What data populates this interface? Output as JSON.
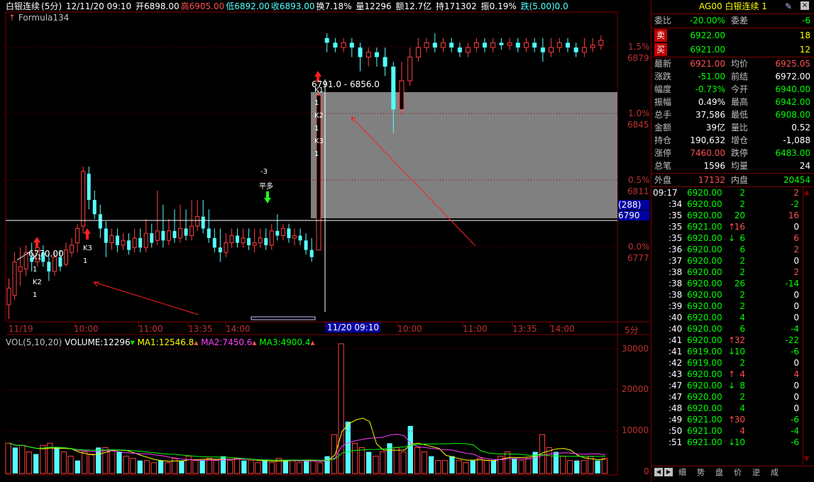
{
  "info_bar": {
    "name": "白银连续",
    "period": "(5分)",
    "datetime": "12/11/20 09:10",
    "open": "开6898.00",
    "high": "高6905.00",
    "low": "低6892.00",
    "close": "收6893.00",
    "turnover": "换7.18%",
    "volume": "量12296",
    "amount": "额12.7亿",
    "hold": "持171302",
    "amplitude": "振0.19%",
    "change": "跌(5.00)0.0"
  },
  "formula": "Formula134",
  "right_axis": {
    "pct_labels": [
      "1.5%",
      "1.0%",
      "0.5%",
      "0.0%"
    ],
    "price_labels": [
      "6879",
      "6845",
      "6811",
      "6777"
    ],
    "cursor_count": "(288)",
    "cursor_price": "6790"
  },
  "chart_annotations": {
    "left_price": "6770.00",
    "left_labels": [
      "K1",
      "1",
      "K2",
      "1"
    ],
    "left_k3": [
      "K3",
      "1"
    ],
    "mid_num": "-3",
    "mid_text": "平多",
    "range_text": "6791.0 - 6856.0",
    "right_labels": [
      "K1",
      "1",
      "K2",
      "1",
      "K3",
      "1"
    ]
  },
  "time_axis": {
    "labels": [
      "11/19",
      "10:00",
      "11:00",
      "13:35",
      "14:00",
      "10:00",
      "11:00",
      "13:35",
      "14:00",
      "5分"
    ],
    "cursor": "11/20 09:10"
  },
  "volume_bar": {
    "title": "VOL(5,10,20)",
    "volume": "VOLUME:12296",
    "ma1": "MA1:12546.8",
    "ma2": "MA2:7450.6",
    "ma3": "MA3:4900.4",
    "axis": [
      "30000",
      "20000",
      "10000",
      "0"
    ]
  },
  "chart_data": {
    "type": "candlestick",
    "candles_left": [
      [
        6768,
        6775,
        6762,
        6779
      ],
      [
        6772,
        6786,
        6770,
        6790
      ],
      [
        6782,
        6784,
        6776,
        6792
      ],
      [
        6783,
        6790,
        6780,
        6793
      ],
      [
        6788,
        6786,
        6782,
        6794
      ],
      [
        6786,
        6792,
        6784,
        6795
      ],
      [
        6790,
        6786,
        6784,
        6793
      ],
      [
        6786,
        6782,
        6778,
        6790
      ],
      [
        6782,
        6788,
        6780,
        6790
      ],
      [
        6788,
        6784,
        6782,
        6791
      ],
      [
        6785,
        6791,
        6784,
        6794
      ],
      [
        6790,
        6793,
        6788,
        6796
      ],
      [
        6794,
        6800,
        6790,
        6802
      ],
      [
        6801,
        6824,
        6798,
        6826
      ],
      [
        6823,
        6812,
        6808,
        6826
      ],
      [
        6812,
        6806,
        6804,
        6816
      ],
      [
        6806,
        6800,
        6796,
        6810
      ],
      [
        6800,
        6794,
        6788,
        6803
      ],
      [
        6794,
        6797,
        6791,
        6800
      ],
      [
        6797,
        6793,
        6790,
        6800
      ],
      [
        6793,
        6795,
        6791,
        6798
      ],
      [
        6795,
        6791,
        6789,
        6798
      ],
      [
        6792,
        6796,
        6790,
        6800
      ],
      [
        6796,
        6792,
        6790,
        6800
      ],
      [
        6792,
        6798,
        6790,
        6804
      ],
      [
        6798,
        6794,
        6792,
        6802
      ],
      [
        6795,
        6799,
        6793,
        6816
      ],
      [
        6799,
        6795,
        6792,
        6810
      ],
      [
        6795,
        6799,
        6793,
        6804
      ],
      [
        6799,
        6796,
        6794,
        6808
      ],
      [
        6796,
        6800,
        6794,
        6810
      ],
      [
        6800,
        6797,
        6795,
        6808
      ],
      [
        6797,
        6801,
        6795,
        6812
      ],
      [
        6801,
        6805,
        6799,
        6812
      ],
      [
        6805,
        6800,
        6798,
        6812
      ],
      [
        6800,
        6796,
        6794,
        6808
      ],
      [
        6796,
        6792,
        6790,
        6800
      ],
      [
        6792,
        6790,
        6786,
        6800
      ],
      [
        6790,
        6794,
        6788,
        6798
      ],
      [
        6794,
        6797,
        6792,
        6800
      ],
      [
        6797,
        6794,
        6792,
        6800
      ],
      [
        6794,
        6796,
        6792,
        6800
      ],
      [
        6796,
        6793,
        6791,
        6800
      ],
      [
        6793,
        6794,
        6790,
        6800
      ],
      [
        6794,
        6796,
        6792,
        6800
      ],
      [
        6796,
        6793,
        6791,
        6800
      ],
      [
        6793,
        6799,
        6791,
        6802
      ],
      [
        6799,
        6797,
        6795,
        6806
      ],
      [
        6797,
        6800,
        6795,
        6802
      ],
      [
        6800,
        6796,
        6794,
        6802
      ],
      [
        6796,
        6797,
        6793,
        6800
      ],
      [
        6797,
        6795,
        6793,
        6800
      ],
      [
        6795,
        6791,
        6789,
        6798
      ],
      [
        6791,
        6788,
        6786,
        6796
      ]
    ],
    "candles_right": [
      [
        6791,
        6856,
        6791,
        6858
      ],
      [
        6880,
        6878,
        6874,
        6882
      ],
      [
        6878,
        6876,
        6874,
        6880
      ],
      [
        6876,
        6878,
        6874,
        6880
      ],
      [
        6878,
        6876,
        6872,
        6880
      ],
      [
        6876,
        6872,
        6866,
        6878
      ],
      [
        6872,
        6874,
        6868,
        6876
      ],
      [
        6874,
        6872,
        6868,
        6876
      ],
      [
        6872,
        6868,
        6864,
        6876
      ],
      [
        6868,
        6850,
        6840,
        6870
      ],
      [
        6850,
        6862,
        6848,
        6870
      ],
      [
        6862,
        6872,
        6860,
        6876
      ],
      [
        6872,
        6876,
        6870,
        6880
      ],
      [
        6876,
        6878,
        6874,
        6880
      ],
      [
        6878,
        6876,
        6874,
        6882
      ],
      [
        6876,
        6878,
        6874,
        6880
      ],
      [
        6878,
        6876,
        6874,
        6880
      ],
      [
        6876,
        6874,
        6872,
        6878
      ],
      [
        6874,
        6876,
        6872,
        6878
      ],
      [
        6876,
        6878,
        6874,
        6880
      ],
      [
        6878,
        6876,
        6874,
        6880
      ],
      [
        6876,
        6878,
        6874,
        6880
      ],
      [
        6878,
        6877,
        6875,
        6880
      ],
      [
        6877,
        6878,
        6875,
        6880
      ],
      [
        6878,
        6876,
        6874,
        6880
      ],
      [
        6876,
        6878,
        6874,
        6880
      ],
      [
        6878,
        6876,
        6874,
        6880
      ],
      [
        6876,
        6874,
        6870,
        6880
      ],
      [
        6874,
        6876,
        6872,
        6880
      ],
      [
        6876,
        6878,
        6874,
        6880
      ],
      [
        6878,
        6876,
        6874,
        6880
      ],
      [
        6876,
        6874,
        6872,
        6878
      ],
      [
        6874,
        6876,
        6872,
        6880
      ],
      [
        6876,
        6877,
        6874,
        6880
      ],
      [
        6877,
        6879,
        6875,
        6881
      ]
    ],
    "volumes": [
      7000,
      6000,
      6500,
      5000,
      4500,
      6500,
      7000,
      6000,
      5000,
      4000,
      3000,
      5000,
      4500,
      6000,
      6000,
      5500,
      5000,
      4000,
      3500,
      3000,
      3000,
      2500,
      3000,
      2500,
      3500,
      3000,
      4000,
      3000,
      3000,
      3500,
      3000,
      4000,
      3000,
      3500,
      3000,
      3000,
      2500,
      3000,
      2500,
      3500,
      3000,
      3000,
      2500,
      3000,
      3000,
      2500,
      4000,
      9000,
      30000,
      12000,
      7000,
      6000,
      5000,
      4000,
      5000,
      7000,
      6000,
      5000,
      11000,
      6000,
      5000,
      4000,
      3000,
      3000,
      4000,
      3000,
      2500,
      3000,
      3500,
      3000,
      3000,
      4000,
      5000,
      3500,
      3000,
      3500,
      5000,
      9000,
      6000,
      5000,
      4000,
      3000,
      3000,
      3000,
      4000,
      3000,
      3500
    ],
    "ylim": [
      6765,
      6890
    ],
    "vol_ylim": [
      0,
      30000
    ]
  },
  "quote": {
    "title_code": "AG00",
    "title_name": "白银连续",
    "title_num": "1",
    "wb_label": "委比",
    "wb_value": "-20.00%",
    "wc_label": "委差",
    "wc_value": "-6",
    "sell_label": "卖",
    "sell_price": "6922.00",
    "sell_vol": "18",
    "buy_label": "买",
    "buy_price": "6921.00",
    "buy_vol": "12",
    "rows": [
      {
        "l1": "最新",
        "v1": "6921.00",
        "l2": "均价",
        "v2": "6925.05",
        "c1": "red",
        "c2": "red"
      },
      {
        "l1": "涨跌",
        "v1": "-51.00",
        "l2": "前结",
        "v2": "6972.00",
        "c1": "green",
        "c2": "white"
      },
      {
        "l1": "幅度",
        "v1": "-0.73%",
        "l2": "今开",
        "v2": "6940.00",
        "c1": "green",
        "c2": "green"
      },
      {
        "l1": "振幅",
        "v1": "0.49%",
        "l2": "最高",
        "v2": "6942.00",
        "c1": "white",
        "c2": "green"
      },
      {
        "l1": "总手",
        "v1": "37,586",
        "l2": "最低",
        "v2": "6908.00",
        "c1": "white",
        "c2": "green"
      },
      {
        "l1": "金额",
        "v1": "39亿",
        "l2": "量比",
        "v2": "0.52",
        "c1": "white",
        "c2": "white"
      },
      {
        "l1": "持仓",
        "v1": "190,632",
        "l2": "增仓",
        "v2": "-1,088",
        "c1": "white",
        "c2": "white"
      },
      {
        "l1": "涨停",
        "v1": "7460.00",
        "l2": "跌停",
        "v2": "6483.00",
        "c1": "red",
        "c2": "green"
      },
      {
        "l1": "总笔",
        "v1": "1596",
        "l2": "均量",
        "v2": "24",
        "c1": "white",
        "c2": "white"
      }
    ],
    "outer_label": "外盘",
    "outer_value": "17132",
    "inner_label": "内盘",
    "inner_value": "20454"
  },
  "trades": [
    {
      "t": "09:17",
      "p": "6920.00",
      "a": "",
      "v": "2",
      "d": "2",
      "pc": "green",
      "dc": "red"
    },
    {
      "t": ":34",
      "p": "6920.00",
      "a": "",
      "v": "2",
      "d": "-2",
      "pc": "green",
      "dc": "green"
    },
    {
      "t": ":35",
      "p": "6920.00",
      "a": "",
      "v": "20",
      "d": "16",
      "pc": "green",
      "dc": "red"
    },
    {
      "t": ":35",
      "p": "6921.00",
      "a": "↑",
      "v": "16",
      "d": "0",
      "pc": "green",
      "dc": "white",
      "ac": "red",
      "vc": "red"
    },
    {
      "t": ":35",
      "p": "6920.00",
      "a": "↓",
      "v": "6",
      "d": "6",
      "pc": "green",
      "dc": "red",
      "ac": "green"
    },
    {
      "t": ":36",
      "p": "6920.00",
      "a": "",
      "v": "6",
      "d": "2",
      "pc": "green",
      "dc": "red"
    },
    {
      "t": ":37",
      "p": "6920.00",
      "a": "",
      "v": "2",
      "d": "0",
      "pc": "green",
      "dc": "white"
    },
    {
      "t": ":38",
      "p": "6920.00",
      "a": "",
      "v": "2",
      "d": "2",
      "pc": "green",
      "dc": "red"
    },
    {
      "t": ":38",
      "p": "6920.00",
      "a": "",
      "v": "26",
      "d": "-14",
      "pc": "green",
      "dc": "green"
    },
    {
      "t": ":38",
      "p": "6920.00",
      "a": "",
      "v": "2",
      "d": "0",
      "pc": "green",
      "dc": "white"
    },
    {
      "t": ":39",
      "p": "6920.00",
      "a": "",
      "v": "2",
      "d": "0",
      "pc": "green",
      "dc": "white"
    },
    {
      "t": ":40",
      "p": "6920.00",
      "a": "",
      "v": "4",
      "d": "0",
      "pc": "green",
      "dc": "white"
    },
    {
      "t": ":40",
      "p": "6920.00",
      "a": "",
      "v": "6",
      "d": "-4",
      "pc": "green",
      "dc": "green"
    },
    {
      "t": ":41",
      "p": "6920.00",
      "a": "↑",
      "v": "32",
      "d": "-22",
      "pc": "green",
      "dc": "green",
      "ac": "red",
      "vc": "red"
    },
    {
      "t": ":41",
      "p": "6919.00",
      "a": "↓",
      "v": "10",
      "d": "-6",
      "pc": "green",
      "dc": "green",
      "ac": "green"
    },
    {
      "t": ":42",
      "p": "6919.00",
      "a": "",
      "v": "2",
      "d": "0",
      "pc": "green",
      "dc": "white"
    },
    {
      "t": ":43",
      "p": "6920.00",
      "a": "↑",
      "v": "4",
      "d": "4",
      "pc": "green",
      "dc": "red",
      "ac": "red",
      "vc": "red"
    },
    {
      "t": ":47",
      "p": "6920.00",
      "a": "↓",
      "v": "8",
      "d": "0",
      "pc": "green",
      "dc": "white",
      "ac": "green"
    },
    {
      "t": ":47",
      "p": "6920.00",
      "a": "",
      "v": "2",
      "d": "0",
      "pc": "green",
      "dc": "white"
    },
    {
      "t": ":48",
      "p": "6920.00",
      "a": "",
      "v": "4",
      "d": "0",
      "pc": "green",
      "dc": "white"
    },
    {
      "t": ":49",
      "p": "6921.00",
      "a": "↑",
      "v": "30",
      "d": "-6",
      "pc": "green",
      "dc": "green",
      "ac": "red",
      "vc": "red"
    },
    {
      "t": ":50",
      "p": "6921.00",
      "a": "",
      "v": "4",
      "d": "-4",
      "pc": "green",
      "dc": "green",
      "vc": "red"
    },
    {
      "t": ":51",
      "p": "6921.00",
      "a": "↓",
      "v": "10",
      "d": "-6",
      "pc": "green",
      "dc": "green",
      "ac": "green"
    }
  ],
  "bottom_tabs": [
    "细",
    "势",
    "盘",
    "价",
    "逆",
    "成"
  ]
}
